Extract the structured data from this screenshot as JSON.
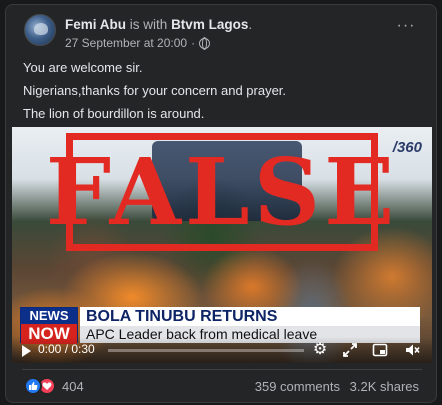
{
  "post": {
    "author": "Femi Abu",
    "with_text": "is with",
    "tagged": "Btvm Lagos",
    "tagged_suffix": ".",
    "timestamp": "27 September at 20:00",
    "separator": "·",
    "audience_icon": "globe-icon",
    "more_icon": "···",
    "lines": [
      "You are welcome sir.",
      "Nigerians,thanks for your concern and prayer.",
      "The lion of bourdillon is around."
    ]
  },
  "video": {
    "stamp_text": "FALSE",
    "watermark": "/360",
    "logo_top": "NEWS",
    "logo_bottom": "NOW",
    "headline": "BOLA TINUBU RETURNS",
    "subheadline": "APC Leader back from medical leave",
    "time": "0:00 / 0:30",
    "progress": 0,
    "stamp_color": "#e32a22"
  },
  "footer": {
    "reaction_count": "404",
    "comments": "359 comments",
    "shares": "3.2K shares"
  },
  "colors": {
    "card_bg": "#242526",
    "page_bg": "#18191a",
    "like": "#2078f4",
    "love": "#f33e58"
  }
}
